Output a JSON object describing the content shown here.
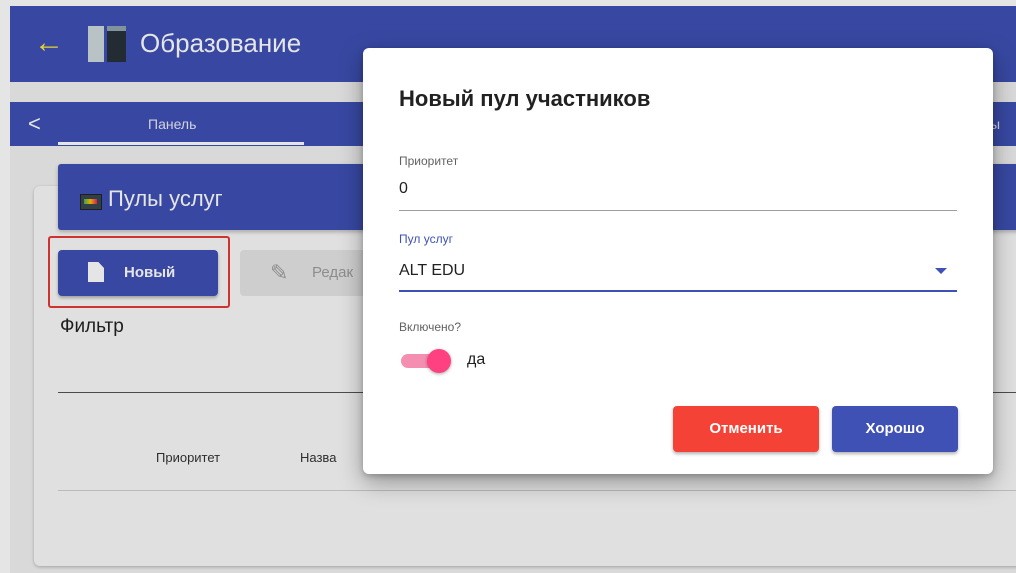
{
  "app": {
    "title": "Образование",
    "back_icon": "arrow-left-icon",
    "logo_icon": "app-logo-icon"
  },
  "nav": {
    "left_chevron": "<",
    "tabs": [
      {
        "label": "Панель",
        "active": true
      }
    ],
    "right_fragment": "ы"
  },
  "card": {
    "title": "Пулы услуг",
    "icon": "pools-icon",
    "toolbar": {
      "new_label": "Новый",
      "edit_label": "Редак"
    },
    "filter_label": "Фильтр",
    "table": {
      "columns": [
        "Приоритет",
        "Назва"
      ]
    }
  },
  "dialog": {
    "title": "Новый пул участников",
    "priority": {
      "label": "Приоритет",
      "value": "0"
    },
    "service_pool": {
      "label": "Пул услуг",
      "value": "ALT EDU"
    },
    "enabled": {
      "label": "Включено?",
      "value": true,
      "text": "да"
    },
    "buttons": {
      "cancel": "Отменить",
      "ok": "Хорошо"
    }
  },
  "colors": {
    "primary": "#3f51b5",
    "accent_back_arrow": "#ffeb3b",
    "cancel": "#f44336",
    "toggle_on": "#ff4081",
    "highlight": "#e53935"
  }
}
